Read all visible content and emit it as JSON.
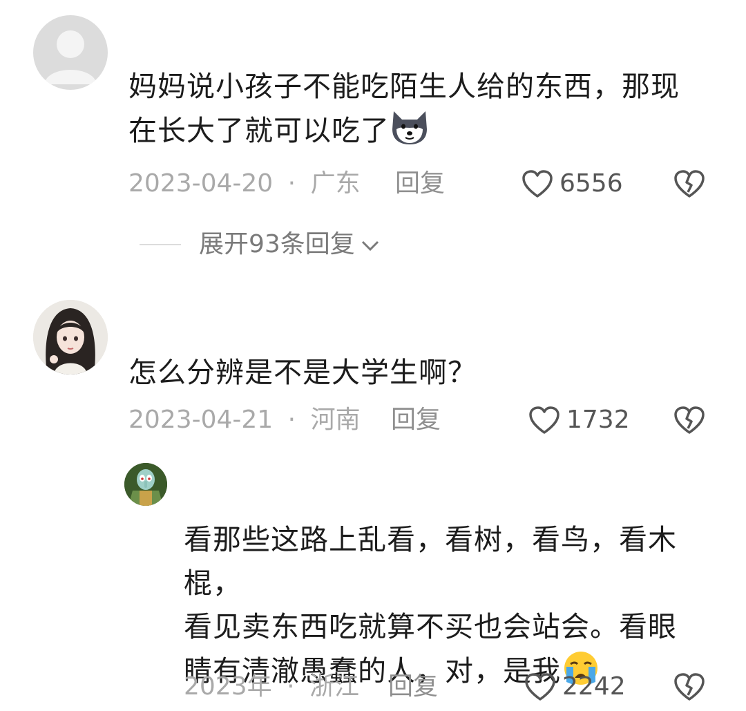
{
  "comments": [
    {
      "text_line1": "妈妈说小孩子不能吃陌生人给的东西，那现",
      "text_line2": "在长大了就可以吃了",
      "emoji": "dog-face-emoji",
      "date": "2023-04-20",
      "dot": "·",
      "location": "广东",
      "reply_label": "回复",
      "likes": "6556",
      "expand_label": "展开93条回复"
    },
    {
      "text": "怎么分辨是不是大学生啊？",
      "date": "2023-04-21",
      "dot": "·",
      "location": "河南",
      "reply_label": "回复",
      "likes": "1732"
    }
  ],
  "reply": {
    "text_line1": "看那些这路上乱看，看树，看鸟，看木棍，",
    "text_line2": "看见卖东西吃就算不买也会站会。看眼",
    "text_line3": "睛有清澈愚蠢的人，对，是我",
    "emoji": "crying-face-emoji",
    "date": "2023年",
    "dot": "·",
    "location": "浙江",
    "reply_label": "回复",
    "likes": "2242"
  },
  "colors": {
    "text": "#1c1c1c",
    "meta": "#a9a9a9",
    "icon": "#555555"
  }
}
